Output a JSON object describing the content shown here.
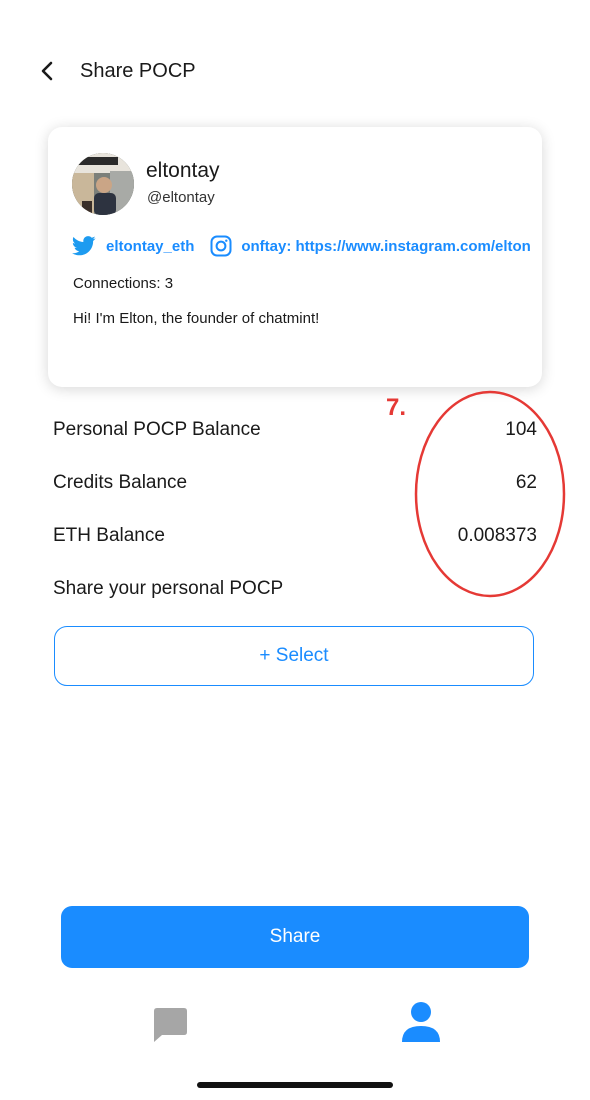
{
  "header": {
    "title": "Share POCP"
  },
  "profile": {
    "name": "eltontay",
    "handle": "@eltontay",
    "twitter": "eltontay_eth",
    "instagram": "onftay: https://www.instagram.com/elton",
    "connections": "Connections: 3",
    "bio": "Hi! I'm Elton, the founder of chatmint!"
  },
  "annotation": {
    "label": "7.",
    "color": "#e53935"
  },
  "balances": [
    {
      "label": "Personal POCP Balance",
      "value": "104"
    },
    {
      "label": "Credits Balance",
      "value": "62"
    },
    {
      "label": "ETH Balance",
      "value": "0.008373"
    }
  ],
  "share_section": {
    "label": "Share your personal POCP",
    "select_label": "+ Select"
  },
  "share_button": {
    "label": "Share"
  },
  "tabbar": {
    "items": [
      {
        "icon": "chat-icon",
        "active": false
      },
      {
        "icon": "profile-icon",
        "active": true
      }
    ]
  },
  "colors": {
    "accent": "#1a8cff",
    "inactive": "#a6a6a6"
  }
}
